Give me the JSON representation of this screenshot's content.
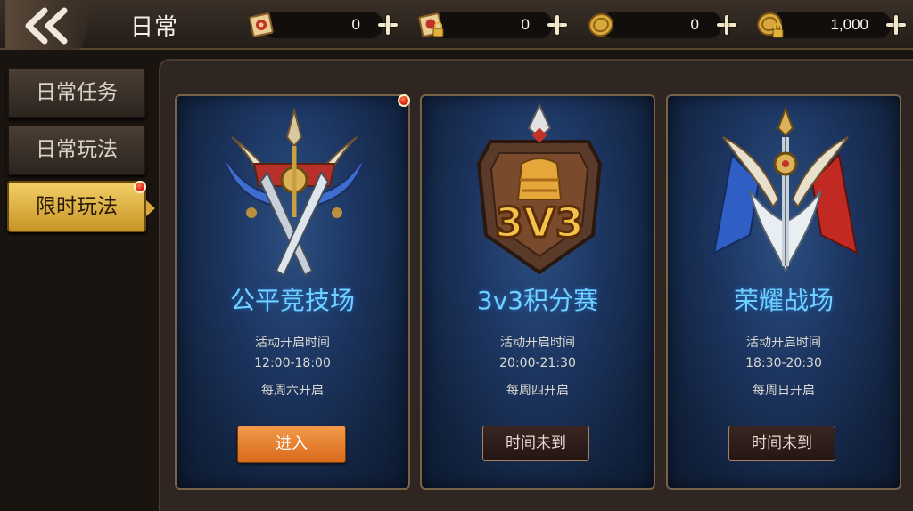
{
  "header": {
    "title": "日常",
    "currencies": [
      {
        "icon": "scroll-icon",
        "value": "0"
      },
      {
        "icon": "locked-scroll-icon",
        "value": "0"
      },
      {
        "icon": "gold-coin-icon",
        "value": "0"
      },
      {
        "icon": "locked-coin-icon",
        "value": "1,000"
      }
    ]
  },
  "sidebar": {
    "items": [
      {
        "label": "日常任务",
        "active": false,
        "badge": false
      },
      {
        "label": "日常玩法",
        "active": false,
        "badge": false
      },
      {
        "label": "限时玩法",
        "active": true,
        "badge": true
      }
    ]
  },
  "cards": [
    {
      "title": "公平竞技场",
      "time_label": "活动开启时间",
      "time": "12:00-18:00",
      "schedule": "每周六开启",
      "button": "进入",
      "button_state": "enabled",
      "badge": true,
      "emblem": "crossed-swords-emblem-icon"
    },
    {
      "title": "3v3积分赛",
      "time_label": "活动开启时间",
      "time": "20:00-21:30",
      "schedule": "每周四开启",
      "button": "时间未到",
      "button_state": "disabled",
      "badge": false,
      "emblem": "3v3-shield-emblem-icon",
      "emblem_text": "3V3"
    },
    {
      "title": "荣耀战场",
      "time_label": "活动开启时间",
      "time": "18:30-20:30",
      "schedule": "每周日开启",
      "button": "时间未到",
      "button_state": "disabled",
      "badge": false,
      "emblem": "winged-banner-emblem-icon"
    }
  ],
  "colors": {
    "accent_gold": "#e2b343",
    "title_cyan": "#6fd1ff",
    "enter_orange": "#e67e2c",
    "badge_red": "#d41d0d"
  }
}
